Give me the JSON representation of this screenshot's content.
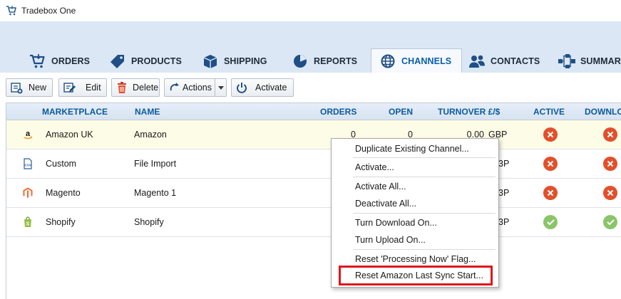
{
  "window": {
    "title": "Tradebox One",
    "icon": "cart-icon"
  },
  "tabs": [
    {
      "label": "ORDERS",
      "icon": "cart-icon",
      "active": false
    },
    {
      "label": "PRODUCTS",
      "icon": "tag-icon",
      "active": false
    },
    {
      "label": "SHIPPING",
      "icon": "box-icon",
      "active": false
    },
    {
      "label": "REPORTS",
      "icon": "pie-chart-icon",
      "active": false
    },
    {
      "label": "CHANNELS",
      "icon": "globe-icon",
      "active": true
    },
    {
      "label": "CONTACTS",
      "icon": "people-icon",
      "active": false
    },
    {
      "label": "SUMMAR",
      "icon": "flowchart-icon",
      "active": false
    }
  ],
  "toolbar": {
    "new_label": "New",
    "edit_label": "Edit",
    "delete_label": "Delete",
    "actions_label": "Actions",
    "activate_label": "Activate"
  },
  "grid": {
    "columns": {
      "marketplace": "MARKETPLACE",
      "name": "NAME",
      "orders": "ORDERS",
      "open": "OPEN",
      "turnover": "TURNOVER £/$",
      "active": "ACTIVE",
      "download": "DOWNLOA"
    },
    "rows": [
      {
        "marketplace": "Amazon UK",
        "name": "Amazon",
        "orders": "0",
        "open": "0",
        "turnover": "0.00",
        "currency": "GBP",
        "active": false,
        "download": false,
        "icon": "amazon-icon"
      },
      {
        "marketplace": "Custom",
        "name": "File Import",
        "orders": "",
        "open": "",
        "turnover": "",
        "currency": "3P",
        "active": false,
        "download": false,
        "icon": "csv-file-icon"
      },
      {
        "marketplace": "Magento",
        "name": "Magento 1",
        "orders": "",
        "open": "",
        "turnover": "",
        "currency": "3P",
        "active": false,
        "download": false,
        "icon": "magento-icon"
      },
      {
        "marketplace": "Shopify",
        "name": "Shopify",
        "orders": "",
        "open": "",
        "turnover": "",
        "currency": "3P",
        "active": true,
        "download": true,
        "icon": "shopify-icon"
      }
    ]
  },
  "context_menu": {
    "items": [
      "Duplicate Existing Channel...",
      "Activate...",
      "Activate All...",
      "Deactivate All...",
      "Turn Download On...",
      "Turn Upload On...",
      "Reset 'Processing Now' Flag...",
      "Reset Amazon Last Sync Start..."
    ],
    "highlighted_item": "Reset Amazon Last Sync Start..."
  },
  "colors": {
    "accent": "#0b5a9e",
    "nav_bg": "#dbe7f5",
    "selected_row": "#fdfce6",
    "status_inactive": "#e2502b",
    "status_active": "#8ac56a",
    "highlight_box": "#e0161b"
  }
}
